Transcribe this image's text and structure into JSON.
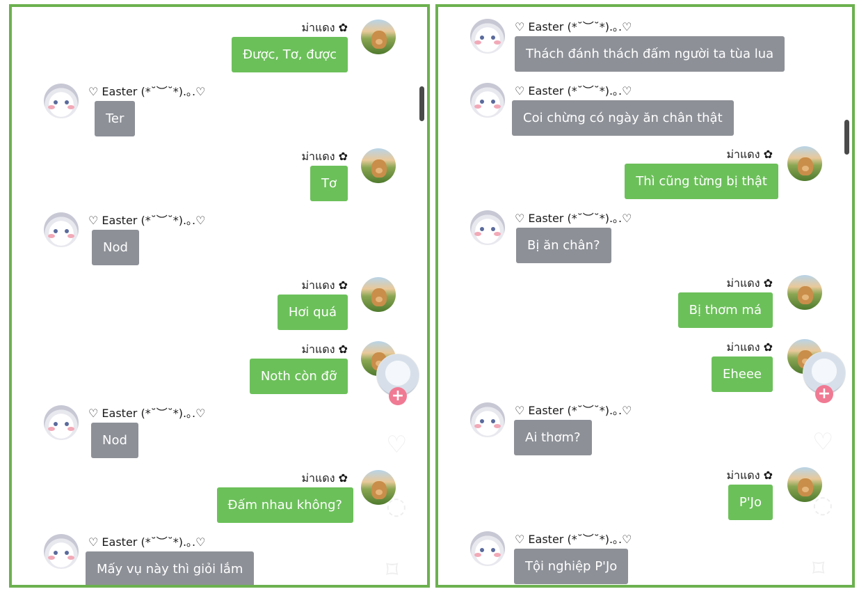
{
  "left_panel": {
    "messages": [
      {
        "side": "me",
        "name": "ม่าแดง ✿",
        "text": "Được, Tơ, được"
      },
      {
        "side": "them",
        "name": "♡ Easter (*˘︶˘*).｡.♡",
        "text": "Ter"
      },
      {
        "side": "me",
        "name": "ม่าแดง ✿",
        "text": "Tơ"
      },
      {
        "side": "them",
        "name": "♡ Easter (*˘︶˘*).｡.♡",
        "text": "Nod"
      },
      {
        "side": "me",
        "name": "ม่าแดง ✿",
        "text": "Hơi quá"
      },
      {
        "side": "me",
        "name": "ม่าแดง ✿",
        "text": "Noth còn đỡ"
      },
      {
        "side": "them",
        "name": "♡ Easter (*˘︶˘*).｡.♡",
        "text": "Nod"
      },
      {
        "side": "me",
        "name": "ม่าแดง ✿",
        "text": "Đấm nhau không?"
      },
      {
        "side": "them",
        "name": "♡ Easter (*˘︶˘*).｡.♡",
        "text": "Mấy vụ này thì giỏi lắm"
      }
    ]
  },
  "right_panel": {
    "messages": [
      {
        "side": "them",
        "name": "♡ Easter (*˘︶˘*).｡.♡",
        "text": "Thách đánh thách đấm người ta tùa lua"
      },
      {
        "side": "them",
        "name": "♡ Easter (*˘︶˘*).｡.♡",
        "text": "Coi chừng có ngày ăn chân thật"
      },
      {
        "side": "me",
        "name": "ม่าแดง ✿",
        "text": "Thì cũng từng bị thật"
      },
      {
        "side": "them",
        "name": "♡ Easter (*˘︶˘*).｡.♡",
        "text": "Bị ăn chân?"
      },
      {
        "side": "me",
        "name": "ม่าแดง ✿",
        "text": "Bị thơm má"
      },
      {
        "side": "me",
        "name": "ม่าแดง ✿",
        "text": "Eheee"
      },
      {
        "side": "them",
        "name": "♡ Easter (*˘︶˘*).｡.♡",
        "text": "Ai thơm?"
      },
      {
        "side": "me",
        "name": "ม่าแดง ✿",
        "text": "P'Jo"
      },
      {
        "side": "them",
        "name": "♡ Easter (*˘︶˘*).｡.♡",
        "text": "Tội nghiệp P'Jo"
      }
    ]
  },
  "floating": {
    "add_symbol": "+"
  },
  "icons": {
    "them_avatar": "bunny-avatar-icon",
    "me_avatar": "dog-avatar-icon",
    "heart": "heart-icon",
    "bookmark": "bookmark-icon",
    "comment": "comment-icon"
  },
  "colors": {
    "frame": "#6cb14f",
    "me_bubble": "#6cc05a",
    "them_bubble": "#8d9097"
  }
}
